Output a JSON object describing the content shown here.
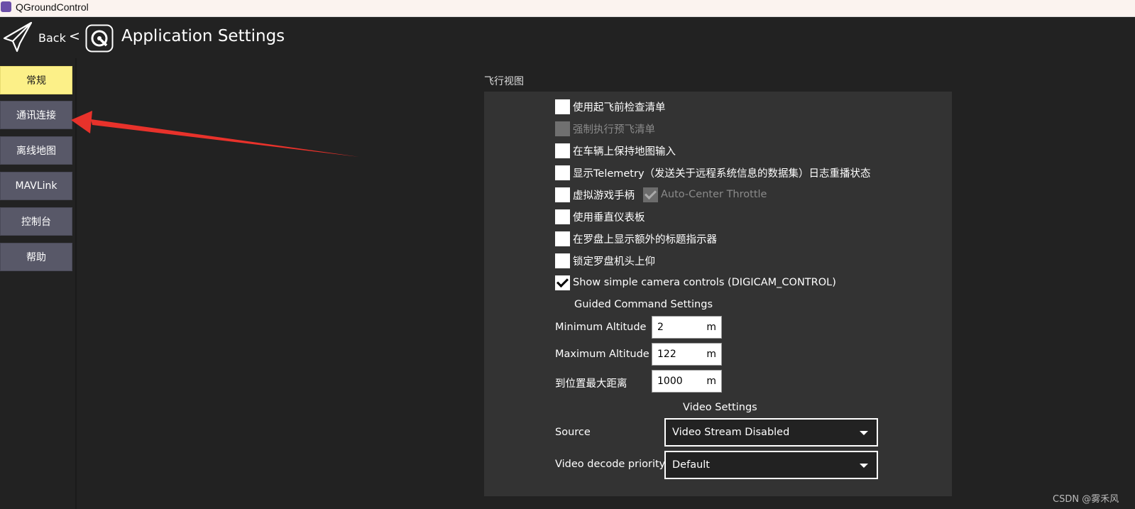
{
  "window": {
    "title": "QGroundControl"
  },
  "header": {
    "back_label": "Back",
    "separator": "<",
    "page_title": "Application Settings"
  },
  "sidebar": {
    "items": [
      {
        "label": "常规",
        "active": true
      },
      {
        "label": "通讯连接",
        "active": false
      },
      {
        "label": "离线地图",
        "active": false
      },
      {
        "label": "MAVLink",
        "active": false
      },
      {
        "label": "控制台",
        "active": false
      },
      {
        "label": "帮助",
        "active": false
      }
    ]
  },
  "fly_view": {
    "section_title": "飞行视图",
    "checkboxes": [
      {
        "label": "使用起飞前检查清单",
        "checked": false,
        "enabled": true
      },
      {
        "label": "强制执行预飞清单",
        "checked": false,
        "enabled": false
      },
      {
        "label": "在车辆上保持地图输入",
        "checked": false,
        "enabled": true
      },
      {
        "label": "显示Telemetry（发送关于远程系统信息的数据集）日志重播状态",
        "checked": false,
        "enabled": true
      },
      {
        "label": "虚拟游戏手柄",
        "checked": false,
        "enabled": true
      },
      {
        "label": "使用垂直仪表板",
        "checked": false,
        "enabled": true
      },
      {
        "label": "在罗盘上显示额外的标题指示器",
        "checked": false,
        "enabled": true
      },
      {
        "label": "锁定罗盘机头上仰",
        "checked": false,
        "enabled": true
      },
      {
        "label": "Show simple camera controls (DIGICAM_CONTROL)",
        "checked": true,
        "enabled": true
      }
    ],
    "auto_center_throttle": {
      "label": "Auto-Center Throttle",
      "checked": true,
      "enabled": false
    }
  },
  "guided": {
    "title": "Guided Command Settings",
    "min_alt": {
      "label": "Minimum Altitude",
      "value": "2",
      "unit": "m"
    },
    "max_alt": {
      "label": "Maximum Altitude",
      "value": "122",
      "unit": "m"
    },
    "max_dist": {
      "label": "到位置最大距离",
      "value": "1000",
      "unit": "m"
    }
  },
  "video": {
    "title": "Video Settings",
    "source": {
      "label": "Source",
      "value": "Video Stream Disabled"
    },
    "decode": {
      "label": "Video decode priority",
      "value": "Default"
    }
  },
  "watermark": "CSDN @雾禾风",
  "colors": {
    "active_nav": "#fcf088",
    "nav": "#585868",
    "background": "#222222",
    "panel": "#333333",
    "annotation_arrow": "#e8322b"
  }
}
